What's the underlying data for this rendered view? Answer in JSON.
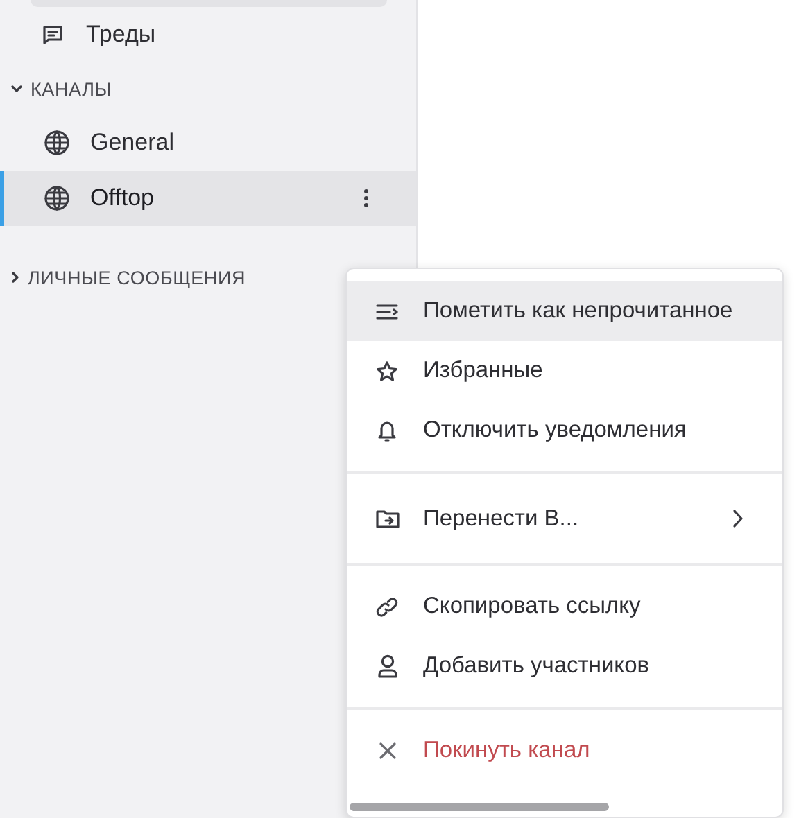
{
  "sidebar": {
    "threads": {
      "label": "Треды"
    },
    "channels_section": {
      "title": "КАНАЛЫ",
      "expanded": true,
      "items": [
        {
          "name": "General",
          "selected": false
        },
        {
          "name": "Offtop",
          "selected": true
        }
      ]
    },
    "dm_section": {
      "title": "ЛИЧНЫЕ СООБЩЕНИЯ",
      "expanded": false
    }
  },
  "context_menu": {
    "groups": [
      [
        {
          "label": "Пометить как непрочитанное",
          "kind": "action",
          "highlighted": true
        },
        {
          "label": "Избранные",
          "kind": "action",
          "highlighted": false
        },
        {
          "label": "Отключить уведомления",
          "kind": "action",
          "highlighted": false
        }
      ],
      [
        {
          "label": "Перенести В...",
          "kind": "submenu",
          "highlighted": false
        }
      ],
      [
        {
          "label": "Скопировать ссылку",
          "kind": "action",
          "highlighted": false
        },
        {
          "label": "Добавить участников",
          "kind": "action",
          "highlighted": false
        }
      ],
      [
        {
          "label": "Покинуть канал",
          "kind": "danger",
          "highlighted": false
        }
      ]
    ]
  }
}
